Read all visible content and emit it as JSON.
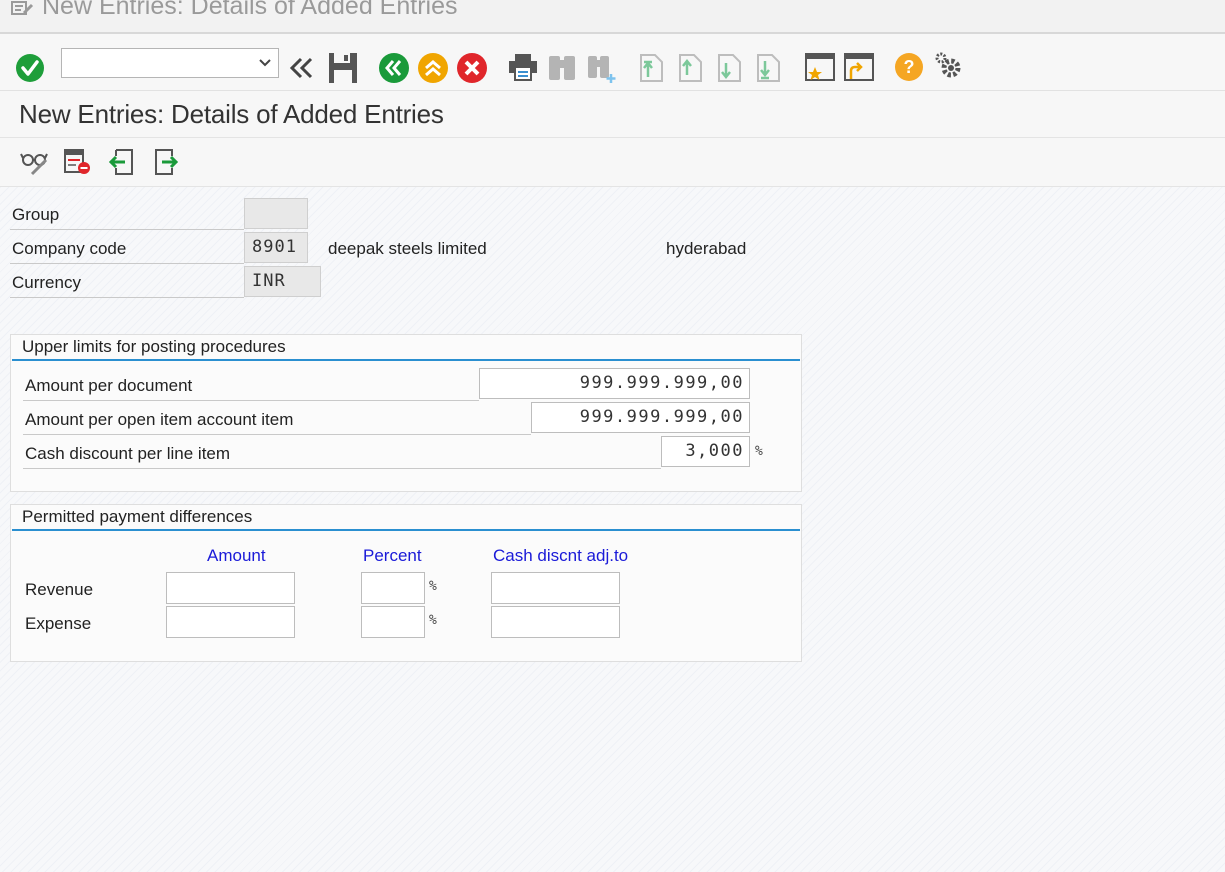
{
  "window": {
    "title": "New Entries: Details of Added Entries"
  },
  "toolbar": {
    "command_field_value": "",
    "icons": [
      "enter-icon",
      "command-dropdown-icon",
      "collapse-icon",
      "save-icon",
      "back-icon",
      "exit-icon",
      "cancel-icon",
      "print-icon",
      "find-icon",
      "find-next-icon",
      "first-page-icon",
      "previous-page-icon",
      "next-page-icon",
      "last-page-icon",
      "create-session-icon",
      "create-shortcut-icon",
      "help-icon",
      "customize-layout-icon"
    ]
  },
  "page": {
    "title": "New Entries: Details of Added Entries"
  },
  "app_toolbar": {
    "icons": [
      "display-change-icon",
      "delete-icon",
      "previous-entry-icon",
      "next-entry-icon"
    ]
  },
  "header_fields": {
    "group_label": "Group",
    "group_value": "",
    "company_code_label": "Company code",
    "company_code_value": "8901",
    "company_name": "deepak steels limited",
    "company_city": "hyderabad",
    "currency_label": "Currency",
    "currency_value": "INR"
  },
  "upper_limits": {
    "title": "Upper limits for posting procedures",
    "amount_per_document_label": "Amount per document",
    "amount_per_document_value": "999.999.999,00",
    "amount_per_open_item_label": "Amount per open item account item",
    "amount_per_open_item_value": "999.999.999,00",
    "cash_discount_label": "Cash discount per line item",
    "cash_discount_value": "3,000",
    "percent_sign": "%"
  },
  "payment_differences": {
    "title": "Permitted payment differences",
    "col_amount": "Amount",
    "col_percent": "Percent",
    "col_cash_discount": "Cash discnt adj.to",
    "revenue_label": "Revenue",
    "expense_label": "Expense",
    "percent_sign": "%",
    "revenue_amount": "",
    "revenue_percent": "",
    "revenue_cash_discount": "",
    "expense_amount": "",
    "expense_percent": "",
    "expense_cash_discount": ""
  },
  "colors": {
    "enter_green": "#1e9e3a",
    "nav_green": "#1a9a3a",
    "exit_orange": "#f0a500",
    "cancel_red": "#e0262b",
    "help_orange": "#f5a623",
    "column_header_blue": "#1a1ad8",
    "group_line_blue": "#2a8fd0"
  }
}
